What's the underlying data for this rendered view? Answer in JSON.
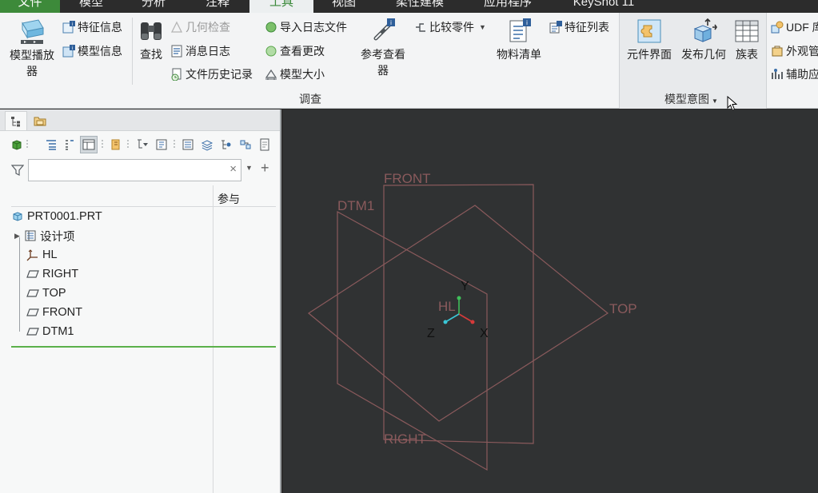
{
  "tabs": [
    {
      "label": "文件"
    },
    {
      "label": "模型"
    },
    {
      "label": "分析"
    },
    {
      "label": "注释"
    },
    {
      "label": "工具"
    },
    {
      "label": "视图"
    },
    {
      "label": "柔性建模"
    },
    {
      "label": "应用程序"
    },
    {
      "label": "KeyShot 11"
    }
  ],
  "ribbon": {
    "model_player": "模型播放器",
    "feature_info": "特征信息",
    "model_info": "模型信息",
    "find": "查找",
    "geometry_check": "几何检查",
    "message_log": "消息日志",
    "file_history": "文件历史记录",
    "import_log": "导入日志文件",
    "view_changes": "查看更改",
    "model_size": "模型大小",
    "reference_viewer_1": "参考查看",
    "reference_viewer_2": "器",
    "compare_part": "比较零件",
    "bom": "物料清单",
    "feature_list": "特征列表",
    "investigate_group": "调查",
    "component_interface": "元件界面",
    "publish_geometry": "发布几何",
    "family_table": "族表",
    "design_intent_group": "模型意图",
    "udf": "UDF 库",
    "appearance_mgr": "外观管",
    "aux_app": "辅助应"
  },
  "panel": {
    "search_placeholder": "",
    "col_participate": "参与",
    "tree": [
      {
        "label": "PRT0001.PRT",
        "icon": "part-icon"
      },
      {
        "label": "设计项",
        "icon": "design-items-icon"
      },
      {
        "label": "HL",
        "icon": "csys-icon"
      },
      {
        "label": "RIGHT",
        "icon": "datum-plane-icon"
      },
      {
        "label": "TOP",
        "icon": "datum-plane-icon"
      },
      {
        "label": "FRONT",
        "icon": "datum-plane-icon"
      },
      {
        "label": "DTM1",
        "icon": "datum-plane-icon"
      }
    ]
  },
  "viewport": {
    "planes": {
      "front": "FRONT",
      "dtm1": "DTM1",
      "top": "TOP",
      "right": "RIGHT"
    },
    "csys": {
      "name": "HL",
      "x": "X",
      "y": "Y",
      "z": "Z"
    }
  },
  "colors": {
    "accent_green": "#3d8a3a",
    "datum_plane": "#8a5a5c",
    "viewport_bg": "#303233"
  }
}
